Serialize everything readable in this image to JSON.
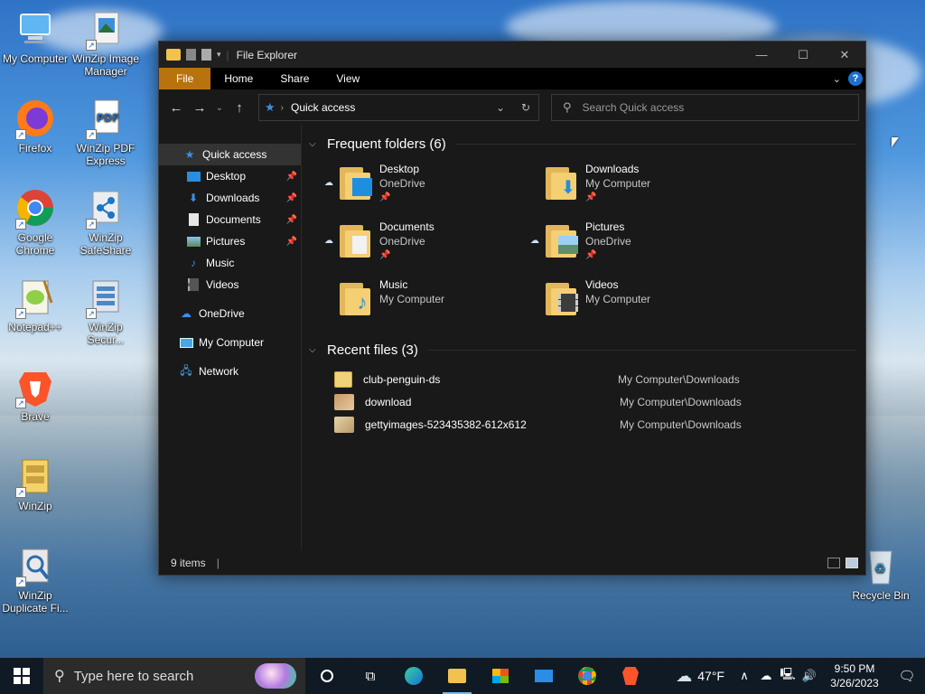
{
  "desktop": {
    "icons": [
      {
        "label": "My Computer",
        "icon": "computer-icon"
      },
      {
        "label": "WinZip Image Manager",
        "icon": "winzip-image-icon"
      },
      {
        "label": "Firefox",
        "icon": "firefox-icon"
      },
      {
        "label": "WinZip PDF Express",
        "icon": "pdf-icon"
      },
      {
        "label": "Google Chrome",
        "icon": "chrome-icon"
      },
      {
        "label": "WinZip SafeShare",
        "icon": "safeshare-icon"
      },
      {
        "label": "Notepad++",
        "icon": "notepadpp-icon"
      },
      {
        "label": "WinZip Secur...",
        "icon": "winzip-secure-icon"
      },
      {
        "label": "Brave",
        "icon": "brave-icon"
      },
      {
        "label": "WinZip",
        "icon": "winzip-icon"
      },
      {
        "label": "WinZip Duplicate Fi...",
        "icon": "winzip-duplicate-icon"
      },
      {
        "label": "Recycle Bin",
        "icon": "recycle-bin-icon"
      }
    ]
  },
  "window": {
    "title": "File Explorer",
    "controls": {
      "minimize": "—",
      "maximize": "☐",
      "close": "✕"
    },
    "ribbon_tabs": [
      "File",
      "Home",
      "Share",
      "View"
    ],
    "help": "?",
    "address": {
      "location": "Quick access"
    },
    "search": {
      "placeholder": "Search Quick access"
    },
    "nav_pane": {
      "items": [
        {
          "label": "Quick access",
          "icon": "star-icon",
          "pinned": false
        },
        {
          "label": "Desktop",
          "icon": "desktop-icon",
          "pinned": true
        },
        {
          "label": "Downloads",
          "icon": "download-icon",
          "pinned": true
        },
        {
          "label": "Documents",
          "icon": "document-icon",
          "pinned": true
        },
        {
          "label": "Pictures",
          "icon": "picture-icon",
          "pinned": true
        },
        {
          "label": "Music",
          "icon": "music-icon",
          "pinned": false
        },
        {
          "label": "Videos",
          "icon": "video-icon",
          "pinned": false
        },
        {
          "label": "OneDrive",
          "icon": "cloud-icon",
          "pinned": false
        },
        {
          "label": "My Computer",
          "icon": "computer-icon",
          "pinned": false
        },
        {
          "label": "Network",
          "icon": "network-icon",
          "pinned": false
        }
      ]
    },
    "frequent": {
      "heading": "Frequent folders (6)",
      "folders": [
        {
          "name": "Desktop",
          "location": "OneDrive",
          "cloud": true,
          "pinned": true
        },
        {
          "name": "Downloads",
          "location": "My Computer",
          "cloud": false,
          "pinned": true
        },
        {
          "name": "Documents",
          "location": "OneDrive",
          "cloud": true,
          "pinned": true
        },
        {
          "name": "Pictures",
          "location": "OneDrive",
          "cloud": true,
          "pinned": true
        },
        {
          "name": "Music",
          "location": "My Computer",
          "cloud": false,
          "pinned": false
        },
        {
          "name": "Videos",
          "location": "My Computer",
          "cloud": false,
          "pinned": false
        }
      ]
    },
    "recent": {
      "heading": "Recent files (3)",
      "files": [
        {
          "name": "club-penguin-ds",
          "path": "My Computer\\Downloads"
        },
        {
          "name": "download",
          "path": "My Computer\\Downloads"
        },
        {
          "name": "gettyimages-523435382-612x612",
          "path": "My Computer\\Downloads"
        }
      ]
    },
    "status": {
      "items": "9 items"
    }
  },
  "taskbar": {
    "search_placeholder": "Type here to search",
    "weather": "47°F",
    "time": "9:50 PM",
    "date": "3/26/2023"
  }
}
